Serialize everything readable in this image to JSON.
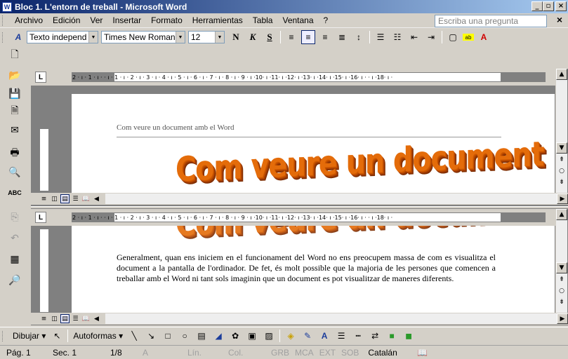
{
  "window": {
    "title": "Bloc 1. L'entorn de treball - Microsoft Word",
    "app_icon": "word-icon",
    "controls": [
      "_",
      "□",
      "X"
    ]
  },
  "menu": {
    "items": [
      "Archivo",
      "Edición",
      "Ver",
      "Insertar",
      "Formato",
      "Herramientas",
      "Tabla",
      "Ventana",
      "?"
    ],
    "ask_placeholder": "Escriba una pregunta",
    "close_doc": "×"
  },
  "format_toolbar": {
    "style_value": "Texto independ",
    "font_value": "Times New Roman",
    "size_value": "12",
    "bold_label": "N",
    "italic_label": "K",
    "underline_label": "S"
  },
  "rulers": {
    "top_text": "2 · ı · 1 · ı ·   · ı · 1 · ı · 2 · ı · 3 · ı · 4 · ı · 5 · ı · 6 · ı · 7 · ı · 8 · ı · 9 · ı ·10· ı ·11· ı ·12· ı ·13· ı ·14· ı ·15· ı ·16· ı ·  · ı ·18· ı ·",
    "tab_selector": "L"
  },
  "document": {
    "header_text": "Com veure un document amb el Word",
    "wordart_text": "Com veure un document",
    "body_paragraph": "Generalment, quan ens iniciem en el funcionament del Word no ens preocupem massa de com es visualitza el document a la pantalla de l'ordinador. De fet, és molt possible que la majoria de les persones que comencen a treballar amb el Word ni tant sols imaginin que un document es pot visualitzar de maneres diferents."
  },
  "view_buttons": [
    "normal-view-icon",
    "web-view-icon",
    "print-view-icon",
    "outline-view-icon",
    "reading-view-icon"
  ],
  "drawing_toolbar": {
    "draw_label": "Dibujar",
    "autoshapes_label": "Autoformas"
  },
  "status_bar": {
    "page": "Pág. 1",
    "section": "Sec. 1",
    "pages": "1/8",
    "at": "A",
    "line": "Lín.",
    "col": "Col.",
    "grb": "GRB",
    "mca": "MCA",
    "ext": "EXT",
    "sob": "SOB",
    "language": "Catalán",
    "book_icon": "spellcheck-book-icon"
  }
}
